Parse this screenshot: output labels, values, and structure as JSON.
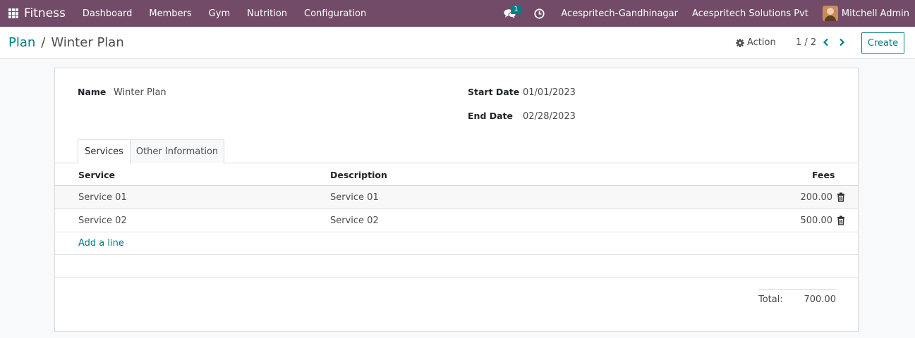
{
  "navbar": {
    "app_name": "Fitness",
    "menu": [
      "Dashboard",
      "Members",
      "Gym",
      "Nutrition",
      "Configuration"
    ],
    "chat_badge": "1",
    "branch": "Acespritech-Gandhinagar",
    "company": "Acespritech Solutions Pvt",
    "user": "Mitchell Admin",
    "color": "#714b67"
  },
  "control": {
    "breadcrumb_parent": "Plan",
    "breadcrumb_separator": "/",
    "breadcrumb_current": "Winter Plan",
    "action_label": "Action",
    "pager": "1 / 2",
    "create_label": "Create"
  },
  "form": {
    "name_label": "Name",
    "name_value": "Winter Plan",
    "start_label": "Start Date",
    "start_value": "01/01/2023",
    "end_label": "End Date",
    "end_value": "02/28/2023"
  },
  "tabs": [
    "Services",
    "Other Information"
  ],
  "services": {
    "columns": [
      "Service",
      "Description",
      "Fees"
    ],
    "rows": [
      {
        "service": "Service 01",
        "description": "Service 01",
        "fees": "200.00"
      },
      {
        "service": "Service 02",
        "description": "Service 02",
        "fees": "500.00"
      }
    ],
    "add_line": "Add a line"
  },
  "totals": {
    "label": "Total:",
    "value": "700.00"
  },
  "colors": {
    "accent": "#017e84",
    "brand": "#714b67"
  }
}
